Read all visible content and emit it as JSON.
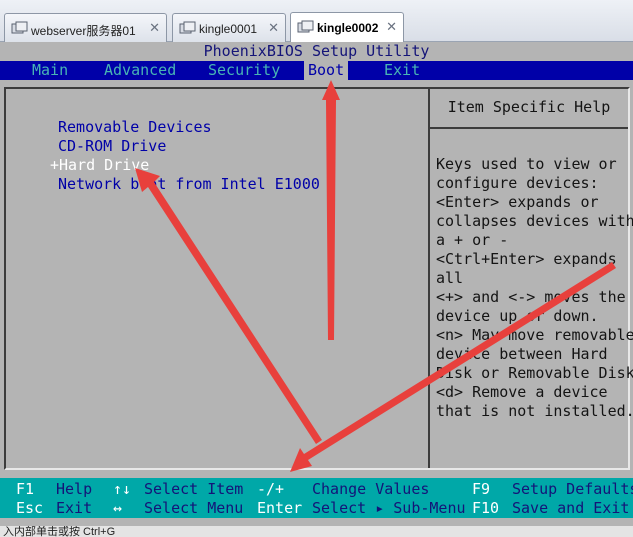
{
  "tabs": [
    {
      "label": "webserver服务器01",
      "close": "✕",
      "active": false
    },
    {
      "label": "kingle0001",
      "close": "✕",
      "active": false
    },
    {
      "label": "kingle0002",
      "close": "✕",
      "active": true
    }
  ],
  "bios": {
    "title": "PhoenixBIOS Setup Utility",
    "menu": [
      "Main",
      "Advanced",
      "Security",
      "Boot",
      "Exit"
    ],
    "active_menu": "Boot",
    "boot_order": [
      "Removable Devices",
      "CD-ROM Drive",
      "Hard Drive",
      "Network boot from Intel E1000"
    ],
    "selected_marker": "+",
    "help": {
      "title": "Item Specific Help",
      "lines": [
        "Keys used to view or",
        "configure devices:",
        "<Enter> expands or",
        "collapses devices with",
        "a + or -",
        "<Ctrl+Enter> expands",
        "all",
        "<+> and <-> moves the",
        "device up or down.",
        "<n> May move removable",
        "device between Hard",
        "Disk or Removable Disk",
        "<d> Remove a device",
        "that is not installed."
      ]
    },
    "keys": {
      "f1": "F1",
      "help": "Help",
      "updown": "↑↓",
      "select_item": "Select Item",
      "minusplus": "-/+",
      "change_values": "Change Values",
      "f9": "F9",
      "setup_defaults": "Setup Defaults",
      "esc": "Esc",
      "exit": "Exit",
      "leftright": "↔",
      "select_menu": "Select Menu",
      "enter": "Enter",
      "select_submenu": "Select ▸ Sub-Menu",
      "f10": "F10",
      "save_exit": "Save and Exit"
    }
  },
  "status": {
    "text": "入内部单击或按 Ctrl+G"
  },
  "colors": {
    "bios_blue": "#0000a8",
    "bios_gray": "#b4b4b4",
    "bios_cyan": "#00a8a8",
    "annotation_red": "#e8403c"
  }
}
